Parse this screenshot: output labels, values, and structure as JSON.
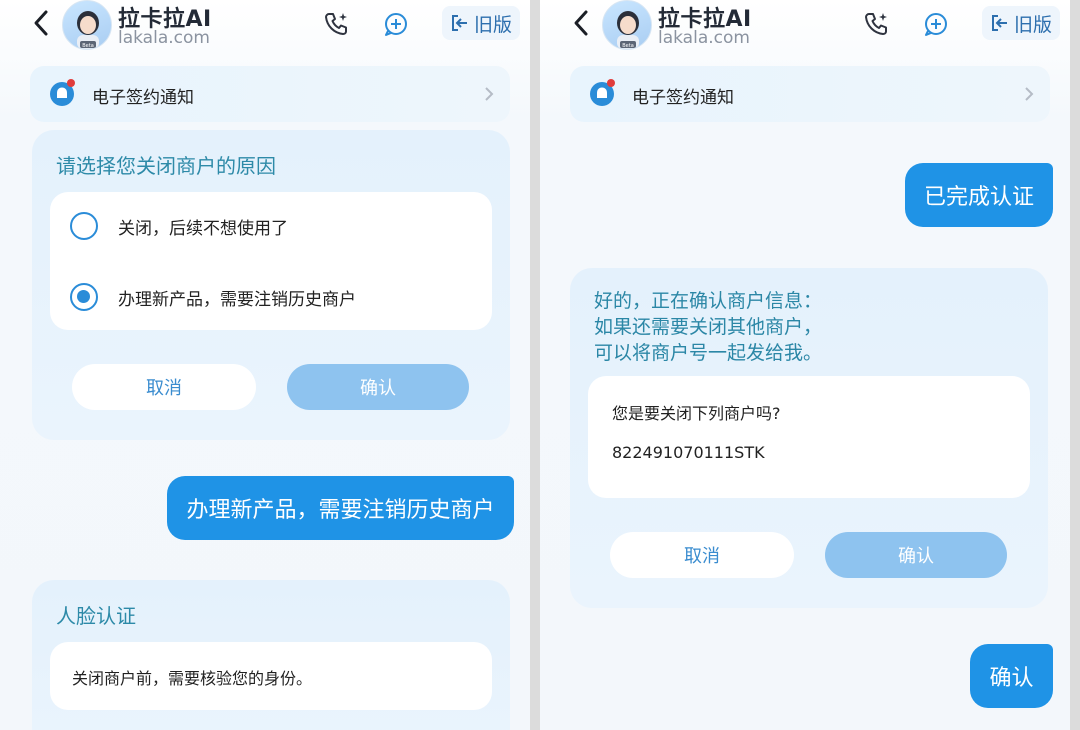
{
  "colors": {
    "accent": "#1f93e6",
    "confirm_disabled": "#8ec3ef",
    "title_teal": "#2d8aa8",
    "card_bg": "#e4f1fc"
  },
  "header": {
    "brand": "拉卡拉AI",
    "domain": "lakala.com",
    "avatar_badge": "Beta",
    "old_version_label": "旧版",
    "icons": [
      "back-arrow-icon",
      "phone-icon",
      "new-chat-icon",
      "exit-icon"
    ]
  },
  "notice": {
    "label": "电子签约通知",
    "icon": "bell-icon"
  },
  "left": {
    "reason_card": {
      "title": "请选择您关闭商户的原因",
      "options": [
        {
          "label": "关闭，后续不想使用了",
          "selected": false
        },
        {
          "label": "办理新产品，需要注销历史商户",
          "selected": true
        }
      ],
      "cancel_label": "取消",
      "confirm_label": "确认"
    },
    "user_message": "办理新产品，需要注销历史商户",
    "face_card": {
      "title": "人脸认证",
      "text": "关闭商户前，需要核验您的身份。"
    }
  },
  "right": {
    "user_message_1": "已完成认证",
    "reply_card": {
      "lines": [
        "好的，正在确认商户信息：",
        "如果还需要关闭其他商户，",
        "可以将商户号一起发给我。"
      ],
      "question": "您是要关闭下列商户吗?",
      "merchant_id": "822491070111STK",
      "cancel_label": "取消",
      "confirm_label": "确认"
    },
    "user_message_2": "确认"
  }
}
